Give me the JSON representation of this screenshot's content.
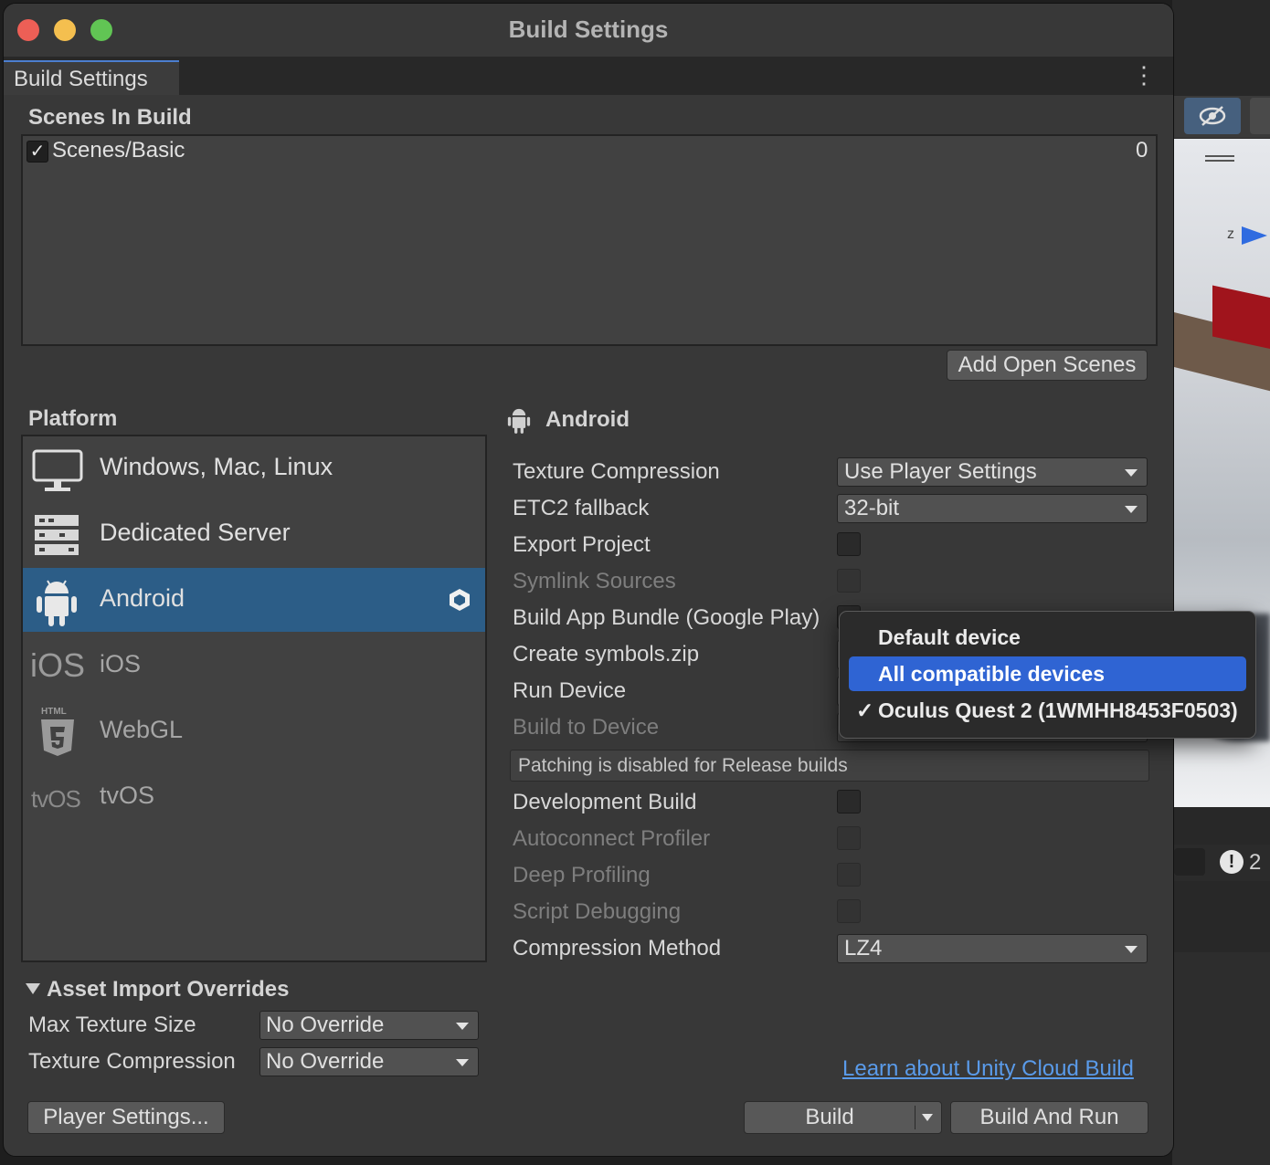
{
  "window": {
    "title": "Build Settings",
    "tab_label": "Build Settings"
  },
  "scenes": {
    "section_title": "Scenes In Build",
    "items": [
      {
        "name": "Scenes/Basic",
        "index": "0",
        "enabled": true
      }
    ],
    "add_open_scenes": "Add Open Scenes"
  },
  "platform": {
    "section_title": "Platform",
    "items": [
      {
        "label": "Windows, Mac, Linux",
        "icon": "monitor-icon",
        "selected": false
      },
      {
        "label": "Dedicated Server",
        "icon": "server-icon",
        "selected": false
      },
      {
        "label": "Android",
        "icon": "android-icon",
        "selected": true
      },
      {
        "label": "iOS",
        "icon": "ios-icon",
        "icon_text": "iOS",
        "selected": false
      },
      {
        "label": "WebGL",
        "icon": "html5-icon",
        "icon_text": "HTML",
        "selected": false
      },
      {
        "label": "tvOS",
        "icon": "tvos-icon",
        "icon_text": "tvOS",
        "selected": false
      }
    ]
  },
  "android": {
    "header": "Android",
    "texture_compression": {
      "label": "Texture Compression",
      "value": "Use Player Settings"
    },
    "etc2_fallback": {
      "label": "ETC2 fallback",
      "value": "32-bit"
    },
    "export_project": {
      "label": "Export Project"
    },
    "symlink_sources": {
      "label": "Symlink Sources"
    },
    "build_app_bundle": {
      "label": "Build App Bundle (Google Play)"
    },
    "create_symbols": {
      "label": "Create symbols.zip"
    },
    "run_device": {
      "label": "Run Device"
    },
    "build_to_device": {
      "label": "Build to Device"
    },
    "patching_note": "Patching is disabled for Release builds",
    "development_build": {
      "label": "Development Build"
    },
    "autoconnect_profiler": {
      "label": "Autoconnect Profiler"
    },
    "deep_profiling": {
      "label": "Deep Profiling"
    },
    "script_debugging": {
      "label": "Script Debugging"
    },
    "compression_method": {
      "label": "Compression Method",
      "value": "LZ4"
    }
  },
  "run_device_menu": {
    "options": [
      {
        "label": "Default device",
        "checked": false,
        "highlighted": false
      },
      {
        "label": "All compatible devices",
        "checked": false,
        "highlighted": true
      },
      {
        "label": "Oculus Quest 2 (1WMHH8453F0503)",
        "checked": true,
        "highlighted": false
      }
    ],
    "check_mark": "✓"
  },
  "asset_import": {
    "title": "Asset Import Overrides",
    "max_texture_size": {
      "label": "Max Texture Size",
      "value": "No Override"
    },
    "texture_compression": {
      "label": "Texture Compression",
      "value": "No Override"
    }
  },
  "footer": {
    "learn_link": "Learn about Unity Cloud Build",
    "player_settings": "Player Settings...",
    "build": "Build",
    "build_and_run": "Build And Run"
  },
  "background": {
    "scene_axis_label": "z",
    "console_warning_count": "2"
  },
  "colors": {
    "window_bg": "#383838",
    "selection": "#2c5d87",
    "menu_highlight": "#2f64d3",
    "link": "#5a9bea"
  }
}
